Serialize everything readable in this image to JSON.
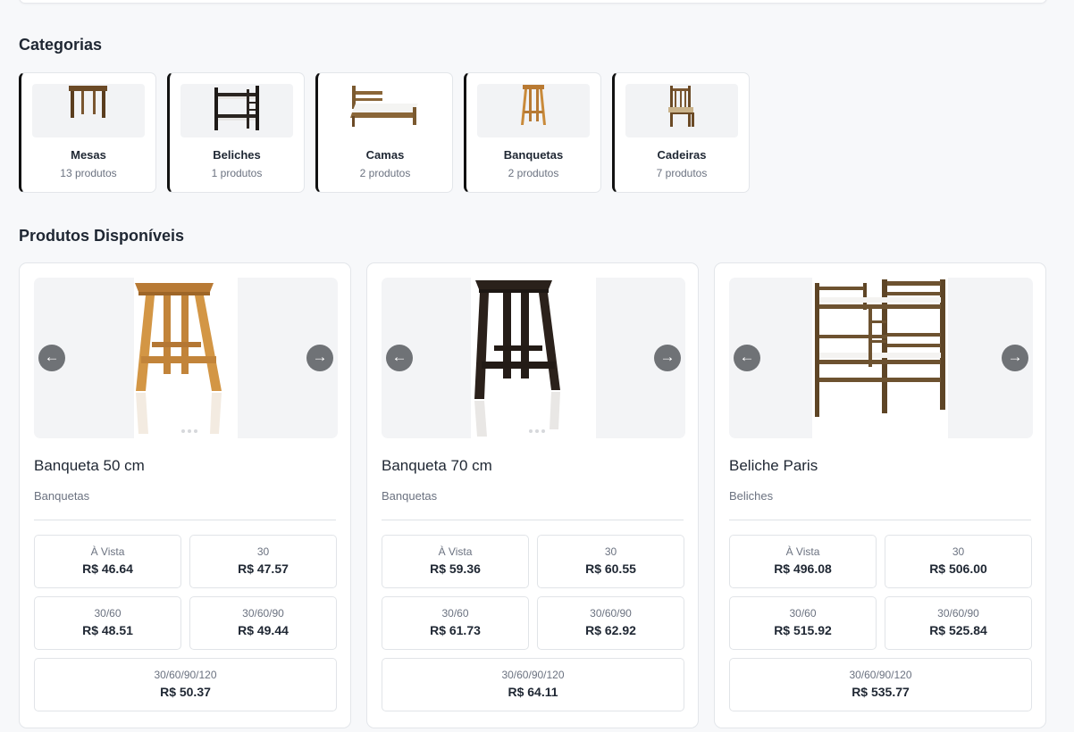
{
  "categories_section": {
    "title": "Categorias",
    "items": [
      {
        "name": "Mesas",
        "count": "13 produtos",
        "icon": "table-image"
      },
      {
        "name": "Beliches",
        "count": "1 produtos",
        "icon": "bunk-bed-image"
      },
      {
        "name": "Camas",
        "count": "2 produtos",
        "icon": "bed-image"
      },
      {
        "name": "Banquetas",
        "count": "2 produtos",
        "icon": "stool-image"
      },
      {
        "name": "Cadeiras",
        "count": "7 produtos",
        "icon": "chair-image"
      }
    ]
  },
  "products_section": {
    "title": "Produtos Disponíveis",
    "prev_arrow": "←",
    "next_arrow": "→",
    "items": [
      {
        "name": "Banqueta 50 cm",
        "category": "Banquetas",
        "image": "light-wood-stool-image",
        "wood_color": "#c98a3a",
        "prices": [
          {
            "label": "À Vista",
            "value": "R$ 46.64"
          },
          {
            "label": "30",
            "value": "R$ 47.57"
          },
          {
            "label": "30/60",
            "value": "R$ 48.51"
          },
          {
            "label": "30/60/90",
            "value": "R$ 49.44"
          },
          {
            "label": "30/60/90/120",
            "value": "R$ 50.37"
          }
        ]
      },
      {
        "name": "Banqueta 70 cm",
        "category": "Banquetas",
        "image": "dark-wood-stool-image",
        "wood_color": "#2a201a",
        "prices": [
          {
            "label": "À Vista",
            "value": "R$ 59.36"
          },
          {
            "label": "30",
            "value": "R$ 60.55"
          },
          {
            "label": "30/60",
            "value": "R$ 61.73"
          },
          {
            "label": "30/60/90",
            "value": "R$ 62.92"
          },
          {
            "label": "30/60/90/120",
            "value": "R$ 64.11"
          }
        ]
      },
      {
        "name": "Beliche Paris",
        "category": "Beliches",
        "image": "bunk-bed-image",
        "wood_color": "#6b4f2a",
        "prices": [
          {
            "label": "À Vista",
            "value": "R$ 496.08"
          },
          {
            "label": "30",
            "value": "R$ 506.00"
          },
          {
            "label": "30/60",
            "value": "R$ 515.92"
          },
          {
            "label": "30/60/90",
            "value": "R$ 525.84"
          },
          {
            "label": "30/60/90/120",
            "value": "R$ 535.77"
          }
        ]
      }
    ]
  }
}
